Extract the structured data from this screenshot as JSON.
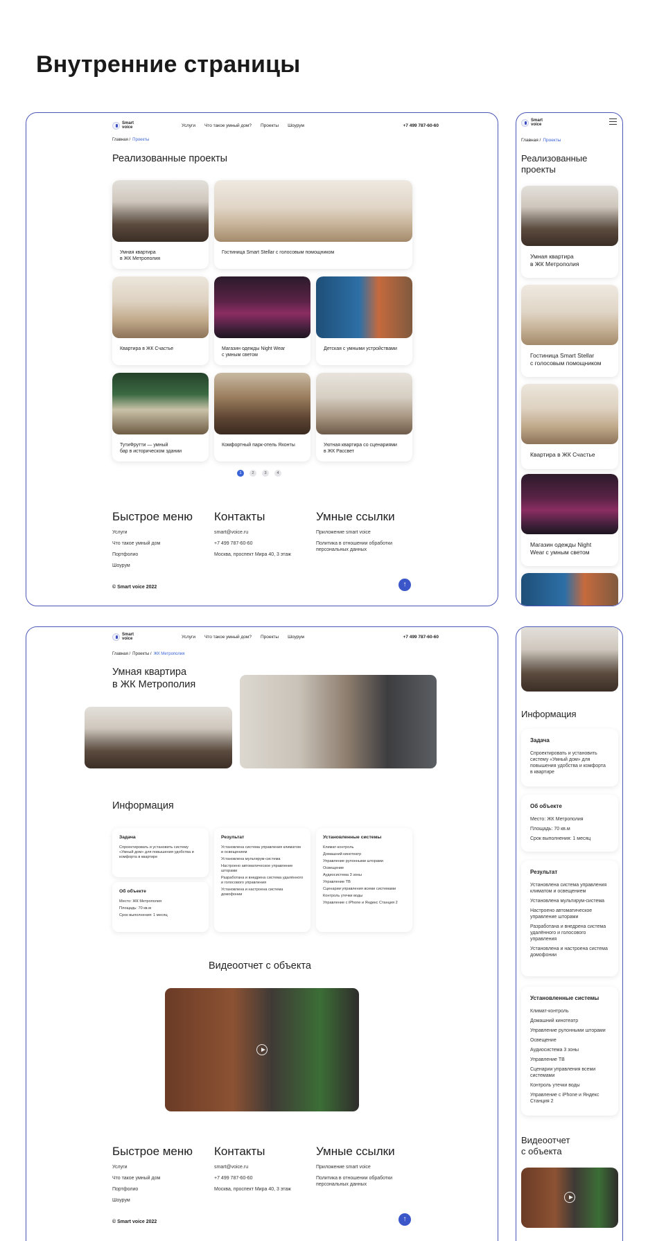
{
  "page_heading": "Внутренние страницы",
  "header": {
    "logo_text": "Smart voice",
    "nav": [
      "Услуги",
      "Что такое умный дом?",
      "Проекты",
      "Шоурум"
    ],
    "phone": "+7 499 787-60-60"
  },
  "projects_page": {
    "breadcrumb": [
      "Главная /",
      "Проекты"
    ],
    "title": "Реализованные проекты",
    "cards": [
      "Умная квартира\nв ЖК Метрополия",
      "Гостиница Smart Stellar с голосовым помощником",
      "Квартира в ЖК Счастье",
      "Магазин одежды Night Wear\nс умным светом",
      "Детская с умными устройствами",
      "ТутиФрутти — умный\nбар в историческом здании",
      "Комфортный парк-отель Яхонты",
      "Уютная квартира со сценариями\nв ЖК Рассвет"
    ],
    "pages": [
      "1",
      "2",
      "3",
      "4"
    ]
  },
  "footer": {
    "menu_title": "Быстрое меню",
    "menu": [
      "Услуги",
      "Что такое умный дом",
      "Портфолио",
      "Шоурум"
    ],
    "contacts_title": "Контакты",
    "contacts": [
      "smart@voice.ru",
      "+7 499 787-60-60",
      "Москва, проспект Мира 40, 3 этаж"
    ],
    "links_title": "Умные ссылки",
    "links": [
      "Приложение smart voice",
      "Политика в отношении обработки\nперсональных данных"
    ],
    "copyright": "© Smart voice 2022",
    "up_arrow": "↑"
  },
  "mobile_projects": {
    "title": "Реализованные\nпроекты",
    "cards": [
      "Умная квартира\nв ЖК Метрополия",
      "Гостиница Smart Stellar\nс голосовым помощником",
      "Квартира в ЖК Счастье",
      "Магазин одежды Night\nWear с умным светом"
    ]
  },
  "project_page": {
    "breadcrumb": [
      "Главная /",
      "Проекты /",
      "ЖК Метрополия"
    ],
    "title": "Умная квартира\nв ЖК Метрополия",
    "info_title": "Информация",
    "task_title": "Задача",
    "task_text": "Спроектировать и установить систему «Умный дом» для повышения удобства и комфорта в квартире",
    "object_title": "Об объекте",
    "object_lines": [
      "Место: ЖК Метрополия",
      "Площадь: 70 кв.м",
      "Срок выполнения: 1 месяц"
    ],
    "result_title": "Результат",
    "result_lines": [
      "Установлена система управления климатом и освещением",
      "Установлена мультирум-система",
      "Настроено автоматическое управление шторами",
      "Разработана и внедрена система удалённого и голосового управления",
      "Установлена и настроена система домофонии"
    ],
    "systems_title": "Установленные системы",
    "systems_lines": [
      "Климат-контроль",
      "Домашний кинотеатр",
      "Управление рулонными шторами",
      "Освещение",
      "Аудиосистема 3 зоны",
      "Управление ТВ",
      "Сценарии управления всеми системами",
      "Контроль утечки воды",
      "Управление с iPhone и Яндекс Станция 2"
    ],
    "video_title": "Видеоотчет с объекта"
  },
  "mobile_project": {
    "info_title": "Информация",
    "task_text": "Спроектировать и установить систему «Умный дом» для повышения удобства и комфорта в квартире",
    "result_lines": [
      "Установлена система управления климатом и освещением",
      "Установлена мультирум-система",
      "Настроено автоматическое управление шторами",
      "Разработана и внедрена система удалённого и голосового управления",
      "Установлена и настроена система домофонии"
    ],
    "systems_lines": [
      "Климат-контроль",
      "Домашний кинотеатр",
      "Управление рулонными шторами",
      "Освещение",
      "Аудиосистема 3 зоны",
      "Управление ТВ",
      "Сценарии управления всеми системами",
      "Контроль утечки воды",
      "Управление с iPhone и Яндекс Станция 2"
    ],
    "video_title": "Видеоотчет\nс объекта"
  },
  "colors": {
    "accent": "#3a63d6",
    "frame": "#4a56b8",
    "button": "#3a56c8"
  }
}
